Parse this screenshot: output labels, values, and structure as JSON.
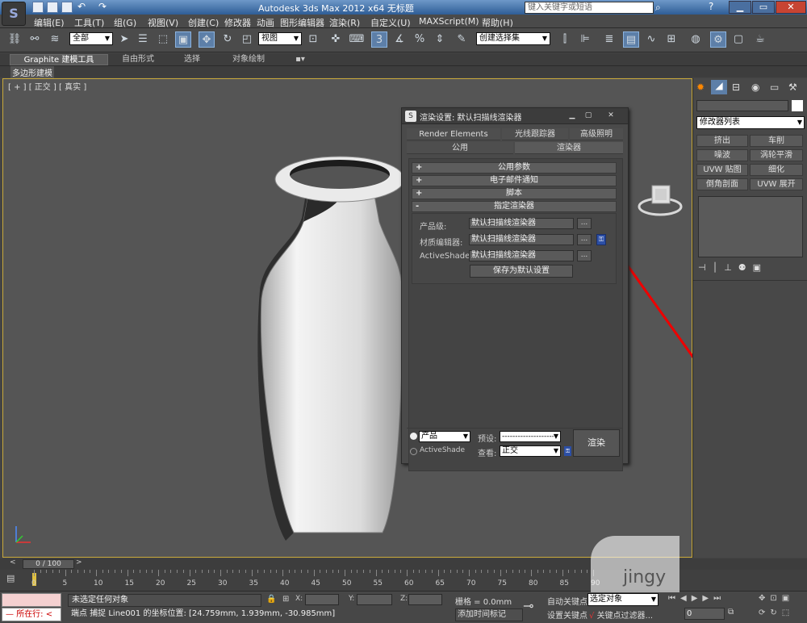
{
  "window": {
    "title": "Autodesk 3ds Max  2012 x64      无标题",
    "search_placeholder": "键入关键字或短语"
  },
  "menu": [
    "编辑(E)",
    "工具(T)",
    "组(G)",
    "视图(V)",
    "创建(C)",
    "修改器",
    "动画",
    "图形编辑器",
    "渲染(R)",
    "自定义(U)",
    "MAXScript(M)",
    "帮助(H)"
  ],
  "toolbar": {
    "selection_filter": "全部",
    "reference_coord": "视图",
    "named_selection": "创建选择集"
  },
  "ribbon": {
    "tabs": [
      "Graphite 建模工具",
      "自由形式",
      "选择",
      "对象绘制"
    ],
    "sub_label": "多边形建模"
  },
  "viewport": {
    "label": "[ + ] [ 正交 ] [ 真实 ]"
  },
  "render_dialog": {
    "title": "渲染设置: 默认扫描线渲染器",
    "tabs_row1": [
      "Render Elements",
      "光线跟踪器",
      "高级照明"
    ],
    "tabs_row2": [
      "公用",
      "渲染器"
    ],
    "rollouts": [
      {
        "sign": "+",
        "label": "公用参数"
      },
      {
        "sign": "+",
        "label": "电子邮件通知"
      },
      {
        "sign": "+",
        "label": "脚本"
      },
      {
        "sign": "-",
        "label": "指定渲染器"
      }
    ],
    "rows": [
      {
        "label": "产品级:",
        "value": "默认扫描线渲染器"
      },
      {
        "label": "材质编辑器:",
        "value": "默认扫描线渲染器"
      },
      {
        "label": "ActiveShade:",
        "value": "默认扫描线渲染器"
      }
    ],
    "save_default": "保存为默认设置",
    "bottom": {
      "mode_product": "产品",
      "mode_activeshade": "ActiveShade",
      "preset_label": "预设:",
      "preset_value": "--------------------",
      "view_label": "查看:",
      "view_value": "正交",
      "render_button": "渲染"
    }
  },
  "command_panel": {
    "modifier_list": "修改器列表",
    "buttons": [
      "挤出",
      "车削",
      "噪波",
      "涡轮平滑",
      "UVW 贴图",
      "细化",
      "倒角剖面",
      "UVW 展开"
    ]
  },
  "timeline": {
    "frame": "0 / 100",
    "ticks": [
      "0",
      "5",
      "10",
      "15",
      "20",
      "25",
      "30",
      "35",
      "40",
      "45",
      "50",
      "55",
      "60",
      "65",
      "70",
      "75",
      "80",
      "85",
      "90"
    ]
  },
  "status": {
    "script_label": "所在行:",
    "selection": "未选定任何对象",
    "prompt": "端点 捕捉 Line001 的坐标位置: [24.759mm, 1.939mm, -30.985mm]",
    "x_label": "X:",
    "y_label": "Y:",
    "z_label": "Z:",
    "grid": "栅格 = 0.0mm",
    "add_time_tag": "添加时间标记",
    "auto_key": "自动关键点",
    "set_key": "设置关键点",
    "selected_option": "选定对象",
    "key_filters": "关键点过滤器...",
    "current_frame": "0"
  },
  "watermark": "jingy"
}
